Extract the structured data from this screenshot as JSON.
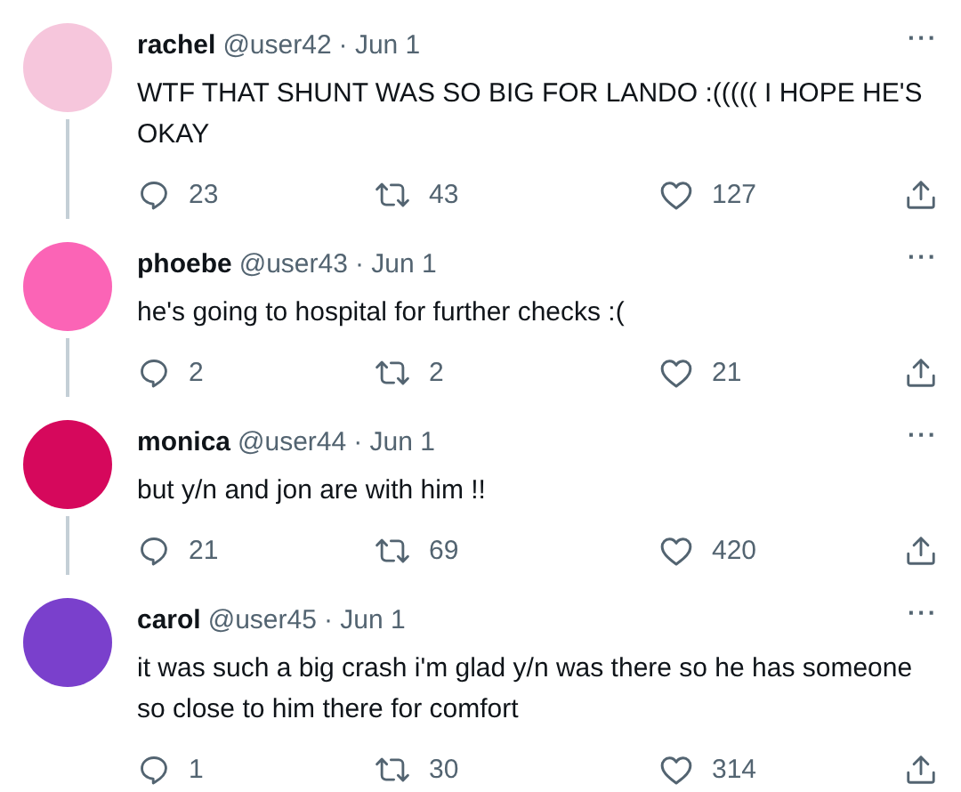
{
  "tweets": [
    {
      "name": "rachel",
      "handle": "@user42",
      "date": "· Jun 1",
      "text": "WTF THAT SHUNT WAS SO BIG FOR LANDO :((((( I HOPE HE'S OKAY",
      "more": "···",
      "replies": "23",
      "retweets": "43",
      "likes": "127",
      "color": "#f6c6dc"
    },
    {
      "name": "phoebe",
      "handle": "@user43",
      "date": "· Jun 1",
      "text": "he's going to hospital for further checks :(",
      "more": "···",
      "replies": "2",
      "retweets": "2",
      "likes": "21",
      "color": "#fb64b6"
    },
    {
      "name": "monica",
      "handle": "@user44",
      "date": "· Jun 1",
      "text": "but y/n and jon are with him !!",
      "more": "···",
      "replies": "21",
      "retweets": "69",
      "likes": "420",
      "color": "#d6085c"
    },
    {
      "name": "carol",
      "handle": "@user45",
      "date": "· Jun 1",
      "text": "it was such a big crash i'm glad y/n was there so he has someone so close to him there for comfort",
      "more": "···",
      "replies": "1",
      "retweets": "30",
      "likes": "314",
      "color": "#7a40cc"
    }
  ]
}
